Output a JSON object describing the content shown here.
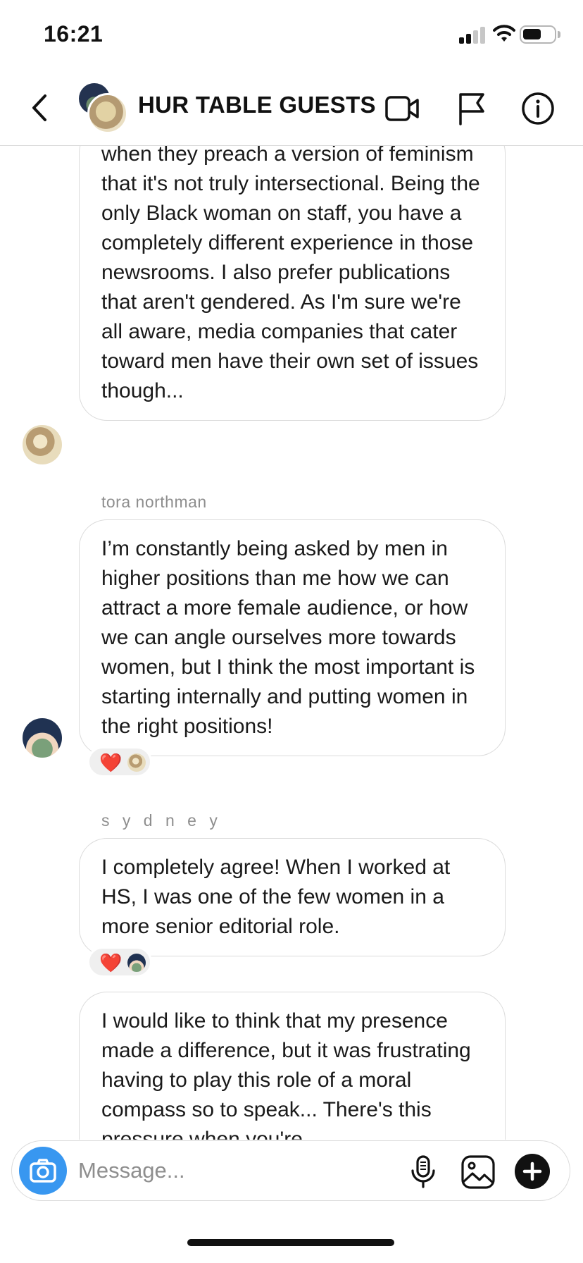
{
  "status_bar": {
    "time": "16:21",
    "battery_level": 0.6,
    "signal_bars": 2
  },
  "header": {
    "title": "HUR TABLE GUESTS",
    "icons": [
      "back-chevron-icon",
      "video-camera-icon",
      "flag-icon",
      "info-icon"
    ]
  },
  "messages": [
    {
      "text": "when they preach a version of feminism that it's not truly intersectional. Being the only Black woman on staff, you have a completely different experience in those newsrooms. I also prefer publications that aren't gendered. As I'm sure we're all aware, media companies that cater toward men have their own set of issues though...",
      "avatar": "cat-avatar"
    },
    {
      "sender": "tora northman",
      "text": "I’m constantly being asked by men in higher positions than me how we can attract a more female audience, or how we can angle ourselves more towards women, but I think the most important is starting internally and putting women in the right positions!",
      "avatar": "girl-avatar",
      "reaction": {
        "emoji": "❤️",
        "by": "cat-avatar"
      }
    },
    {
      "sender": "s y d n e y",
      "text": "I completely agree! When I worked at HS, I was one of the few women in a more senior editorial role.",
      "reaction": {
        "emoji": "❤️",
        "by": "girl-avatar"
      }
    },
    {
      "text": "I would like to think that my presence made a difference, but it was frustrating having to play this role of a moral compass so to speak... There's this pressure when you're"
    }
  ],
  "composer": {
    "placeholder": "Message...",
    "icons": [
      "camera-icon",
      "microphone-icon",
      "gallery-icon",
      "plus-icon"
    ]
  },
  "colors": {
    "accent": "#3897f0",
    "heart": "#e0201f",
    "border": "#dbdbdb",
    "muted_text": "#8e8e8e"
  }
}
